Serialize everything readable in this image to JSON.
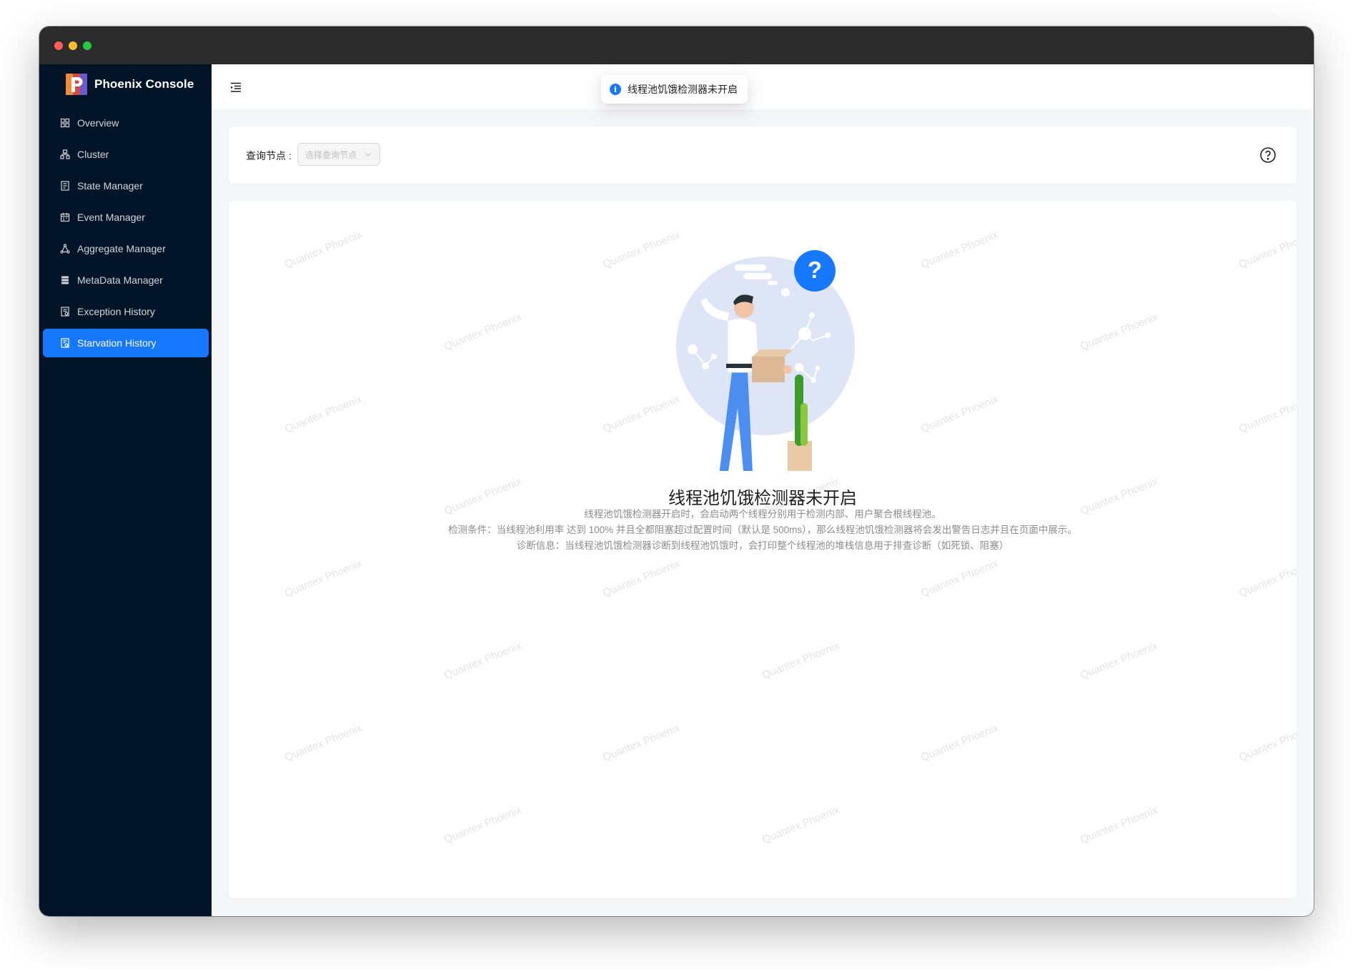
{
  "app": {
    "name": "Phoenix Console"
  },
  "sidebar": {
    "items": [
      {
        "label": "Overview",
        "icon": "dashboard-icon",
        "active": false
      },
      {
        "label": "Cluster",
        "icon": "cluster-icon",
        "active": false
      },
      {
        "label": "State Manager",
        "icon": "state-icon",
        "active": false
      },
      {
        "label": "Event Manager",
        "icon": "event-icon",
        "active": false
      },
      {
        "label": "Aggregate Manager",
        "icon": "aggregate-icon",
        "active": false
      },
      {
        "label": "MetaData Manager",
        "icon": "metadata-icon",
        "active": false
      },
      {
        "label": "Exception History",
        "icon": "exception-icon",
        "active": false
      },
      {
        "label": "Starvation History",
        "icon": "starvation-icon",
        "active": true
      }
    ]
  },
  "toast": {
    "text": "线程池饥饿检测器未开启",
    "icon": "info-icon"
  },
  "filter": {
    "label": "查询节点 :",
    "placeholder": "选择查询节点"
  },
  "empty": {
    "title": "线程池饥饿检测器未开启",
    "lines": [
      "线程池饥饿检测器开启时，会启动两个线程分别用于检测内部、用户聚合根线程池。",
      "检测条件：当线程池利用率 达到 100% 并且全都阻塞超过配置时间（默认是 500ms），那么线程池饥饿检测器将会发出警告日志并且在页面中展示。",
      "诊断信息：当线程池饥饿检测器诊断到线程池饥饿时，会打印整个线程池的堆栈信息用于排查诊断（如死锁、阻塞）"
    ]
  },
  "watermark": {
    "text": "Quantex Phoenix"
  },
  "colors": {
    "sidebar_bg": "#021428",
    "accent": "#1677ff",
    "titlebar": "#2b2b2b"
  }
}
